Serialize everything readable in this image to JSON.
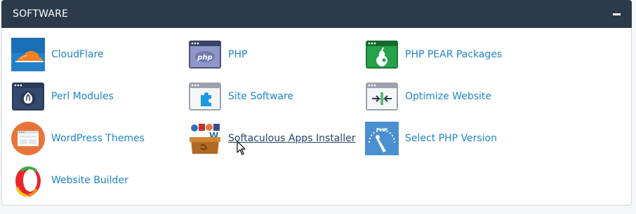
{
  "panel": {
    "title": "SOFTWARE",
    "collapse_icon": "minus-icon"
  },
  "items": [
    {
      "label": "CloudFlare",
      "icon": "cloudflare-icon"
    },
    {
      "label": "PHP",
      "icon": "php-icon"
    },
    {
      "label": "PHP PEAR Packages",
      "icon": "pear-icon"
    },
    {
      "label": "Perl Modules",
      "icon": "perl-onion-icon"
    },
    {
      "label": "Site Software",
      "icon": "puzzle-piece-icon"
    },
    {
      "label": "Optimize Website",
      "icon": "compress-arrows-icon"
    },
    {
      "label": "WordPress Themes",
      "icon": "window-layout-icon"
    },
    {
      "label": "Softaculous Apps Installer",
      "icon": "toolbox-icon"
    },
    {
      "label": "Select PHP Version",
      "icon": "speedometer-icon"
    },
    {
      "label": "Website Builder",
      "icon": "builder-logo-icon"
    }
  ],
  "colors": {
    "header_bg": "#2b3b4c",
    "link": "#1e84c6",
    "hover_link": "#24436a"
  }
}
